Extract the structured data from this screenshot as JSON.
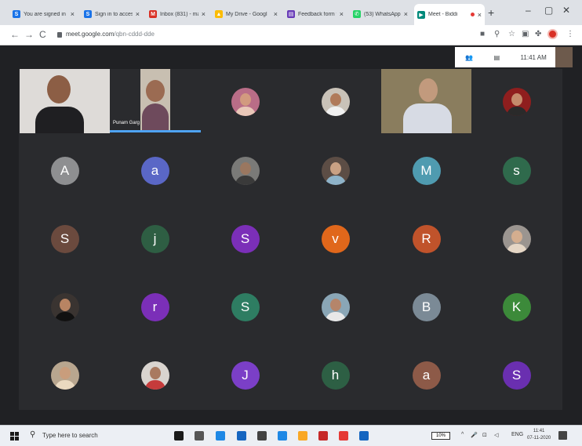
{
  "browser": {
    "tabs": [
      {
        "label": "You are signed in",
        "icon": "S",
        "color": "#1a73e8",
        "active": false
      },
      {
        "label": "Sign in to access",
        "icon": "S",
        "color": "#1a73e8",
        "active": false
      },
      {
        "label": "Inbox (831) - mai",
        "icon": "M",
        "color": "#d93025",
        "active": false
      },
      {
        "label": "My Drive - Googl",
        "icon": "▲",
        "color": "#fbbc04",
        "active": false
      },
      {
        "label": "Feedback form fo",
        "icon": "▤",
        "color": "#673ab7",
        "active": false
      },
      {
        "label": "(53) WhatsApp",
        "icon": "✆",
        "color": "#25d366",
        "active": false
      },
      {
        "label": "Meet - Biddi",
        "icon": "▶",
        "color": "#00897b",
        "active": true
      }
    ],
    "new_tab": "+",
    "controls": {
      "minimize": "–",
      "restore": "▢",
      "close": "✕"
    },
    "nav": {
      "back": "←",
      "forward": "→",
      "reload": "C"
    },
    "url": {
      "host": "meet.google.com",
      "path": "/qbn-cddd-dde"
    },
    "toolbar_icons": [
      "camera-icon",
      "zoom-icon",
      "star-icon",
      "extension-icon",
      "puzzle-icon",
      "profile-icon",
      "menu-icon"
    ]
  },
  "meet": {
    "time": "11:41 AM",
    "speaker_name": "Punam Garg",
    "tiles": [
      {
        "kind": "video",
        "name": "participant-video-1"
      },
      {
        "kind": "video",
        "name": "participant-video-2-speaking"
      },
      {
        "kind": "photo",
        "bg": "#b96d87",
        "skin": "#d29a7f",
        "cloth": "#e9c7b8"
      },
      {
        "kind": "photo",
        "bg": "#c9c2b8",
        "skin": "#b07a5a",
        "cloth": "#f0f0f0"
      },
      {
        "kind": "video",
        "name": "participant-video-3"
      },
      {
        "kind": "photo",
        "bg": "#8f1e1e",
        "skin": "#c58b6c",
        "cloth": "#2a2a2a"
      },
      {
        "kind": "letter",
        "letter": "A",
        "color": "#8e8f91"
      },
      {
        "kind": "letter",
        "letter": "a",
        "color": "#5a67c6"
      },
      {
        "kind": "photo",
        "bg": "#7a7a78",
        "skin": "#9a7760",
        "cloth": "#3a3a3a"
      },
      {
        "kind": "photo",
        "bg": "#5c4d45",
        "skin": "#c9a184",
        "cloth": "#8eb3c9"
      },
      {
        "kind": "letter",
        "letter": "M",
        "color": "#4f9bb0"
      },
      {
        "kind": "letter",
        "letter": "s",
        "color": "#2f6a4c"
      },
      {
        "kind": "letter",
        "letter": "S",
        "color": "#6b4a3e"
      },
      {
        "kind": "letter",
        "letter": "j",
        "color": "#2e5e43"
      },
      {
        "kind": "letter",
        "letter": "S",
        "color": "#7b2fb8"
      },
      {
        "kind": "letter",
        "letter": "v",
        "color": "#e0671b"
      },
      {
        "kind": "letter",
        "letter": "R",
        "color": "#c0532b"
      },
      {
        "kind": "photo",
        "bg": "#9b9590",
        "skin": "#d4ae8f",
        "cloth": "#e5d6c5"
      },
      {
        "kind": "photo",
        "bg": "#3a3431",
        "skin": "#b88463",
        "cloth": "#111111"
      },
      {
        "kind": "letter",
        "letter": "r",
        "color": "#7b2fb8"
      },
      {
        "kind": "letter",
        "letter": "S",
        "color": "#2e7d62"
      },
      {
        "kind": "photo",
        "bg": "#8aa6b6",
        "skin": "#b5856a",
        "cloth": "#e8e8e8"
      },
      {
        "kind": "letter",
        "letter": "B",
        "color": "#7b8a96"
      },
      {
        "kind": "letter",
        "letter": "K",
        "color": "#3c8a3a"
      },
      {
        "kind": "photo",
        "bg": "#b8a68f",
        "skin": "#c99d7c",
        "cloth": "#ead9c0"
      },
      {
        "kind": "photo",
        "bg": "#d9d4cf",
        "skin": "#a97a60",
        "cloth": "#c53b3b"
      },
      {
        "kind": "letter",
        "letter": "J",
        "color": "#7b3fc7"
      },
      {
        "kind": "letter",
        "letter": "h",
        "color": "#2d5f44"
      },
      {
        "kind": "letter",
        "letter": "a",
        "color": "#8d5a48"
      },
      {
        "kind": "letter",
        "letter": "S",
        "color": "#6a2fb0"
      }
    ]
  },
  "taskbar": {
    "search_placeholder": "Type here to search",
    "apps": [
      "#1a1a1a",
      "#555555",
      "#1e88e5",
      "#1565c0",
      "#424242",
      "#1e88e5",
      "#f9a825",
      "#c62828",
      "#e53935",
      "#1565c0"
    ],
    "battery": "10%",
    "lang": "ENG",
    "clock_time": "11:41",
    "clock_date": "07-11-2020"
  }
}
